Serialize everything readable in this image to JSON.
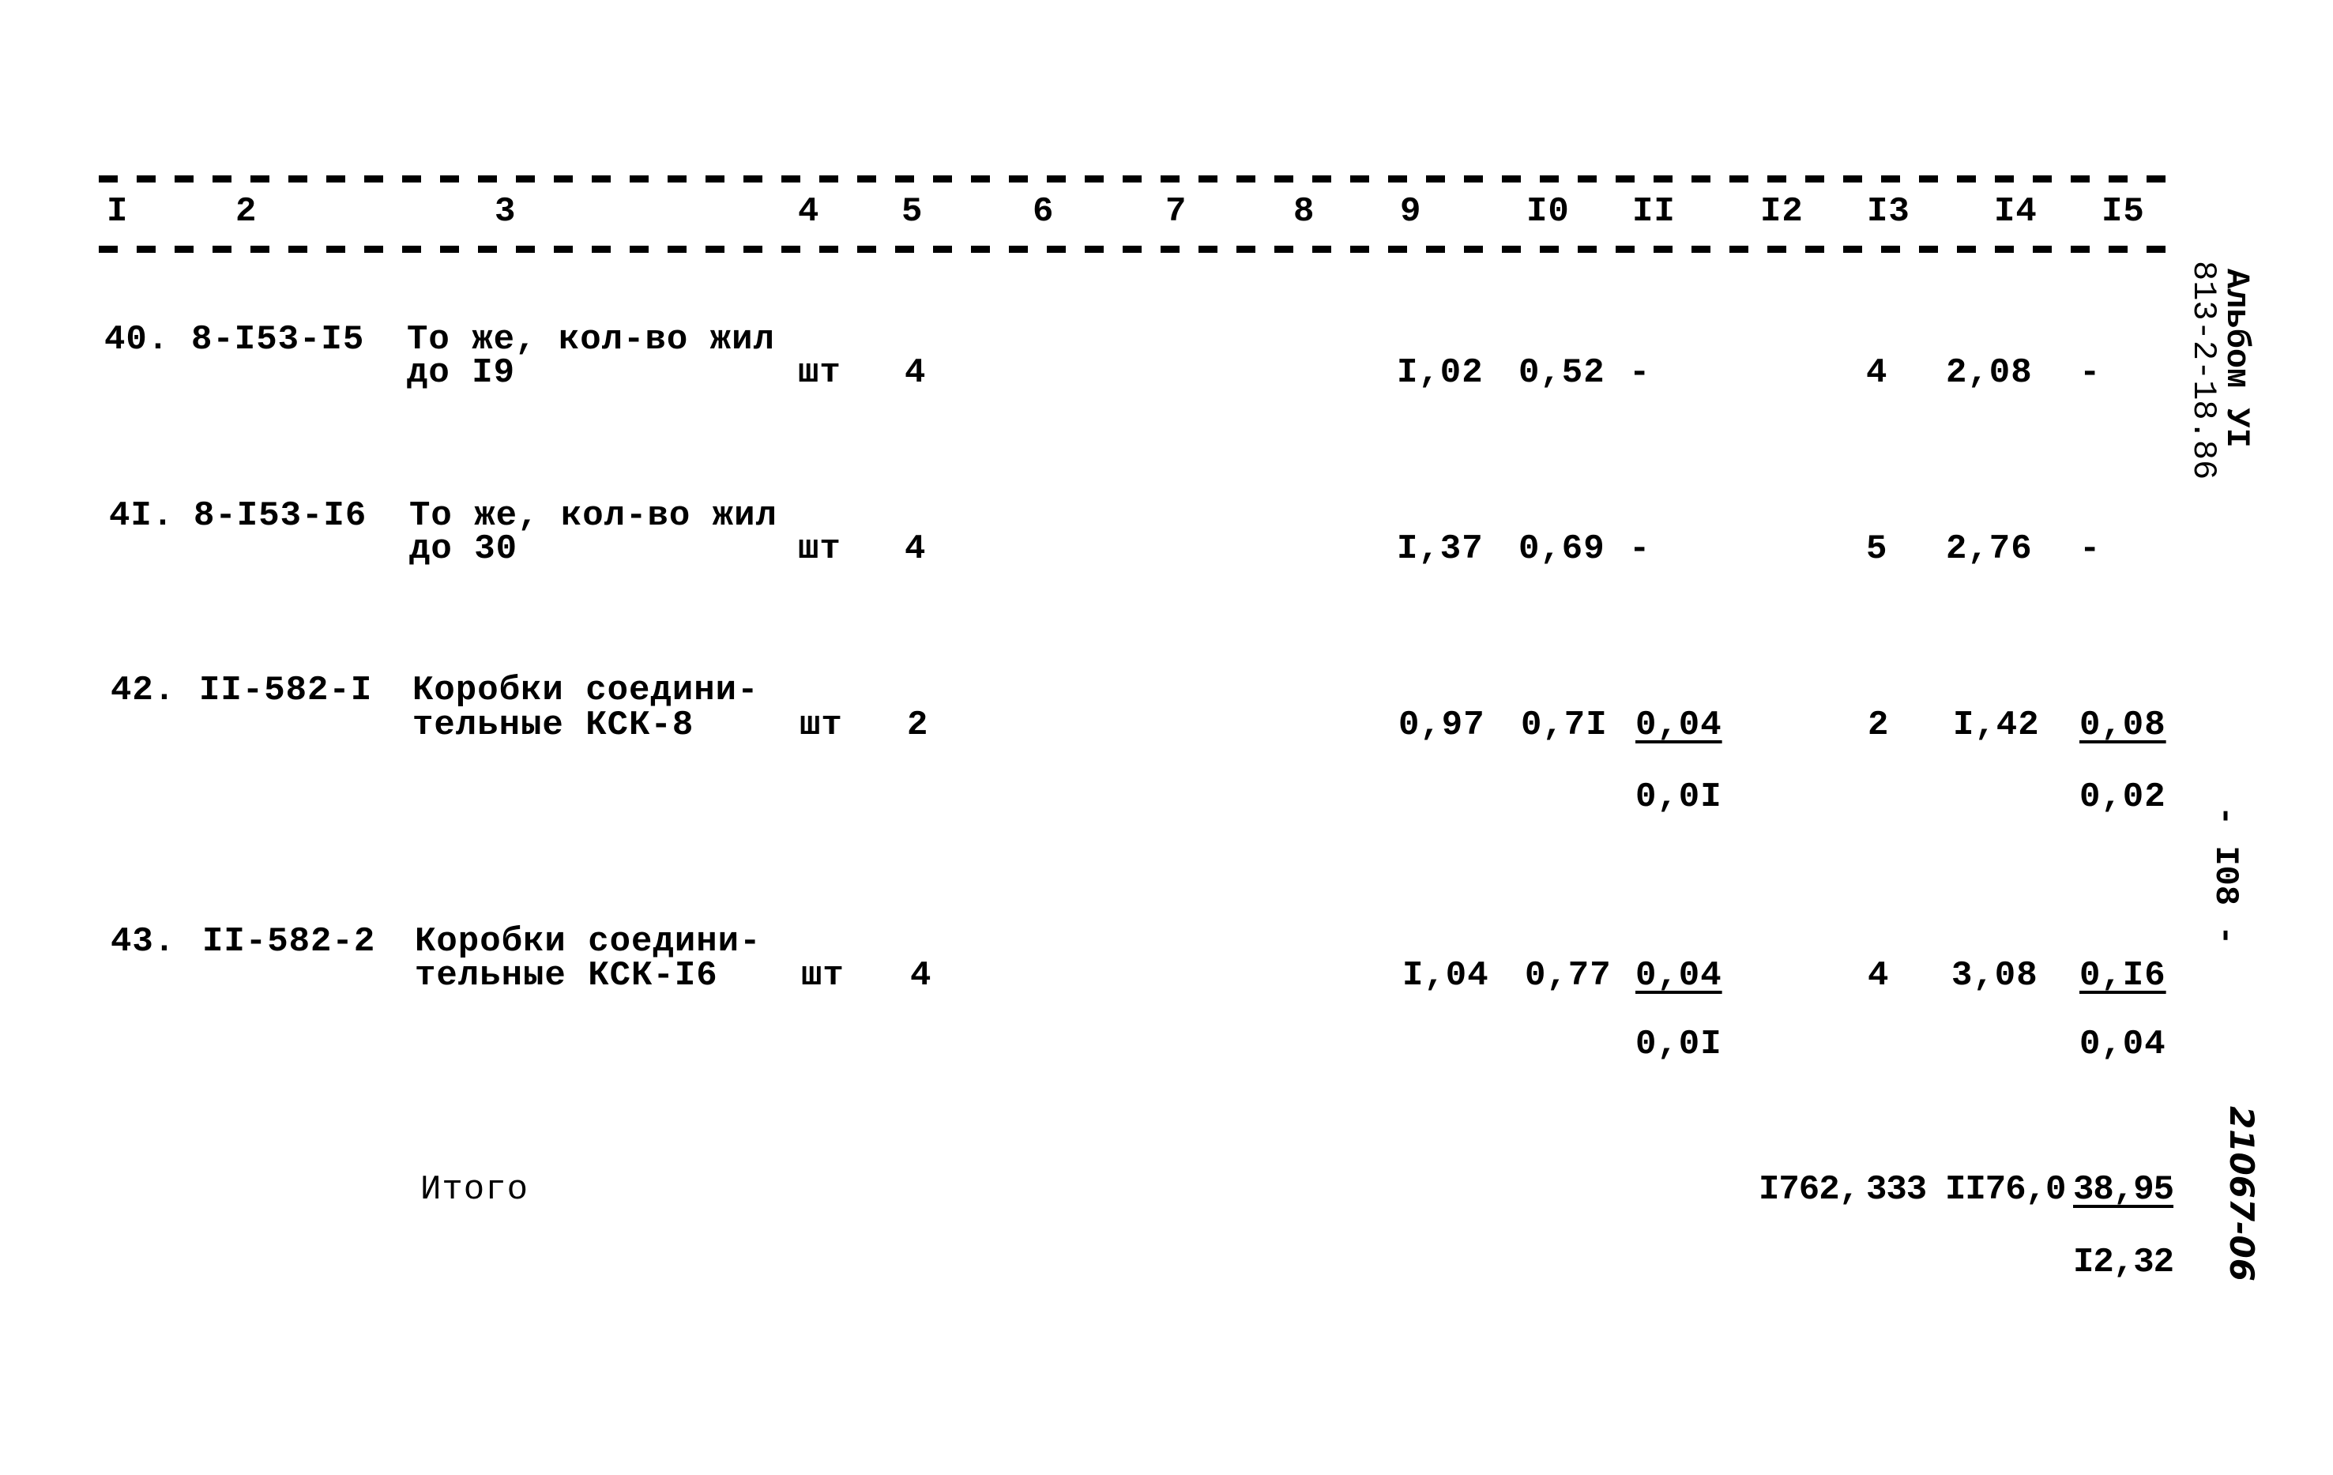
{
  "header": {
    "columns": [
      "I",
      "2",
      "3",
      "4",
      "5",
      "6",
      "7",
      "8",
      "9",
      "I0",
      "II",
      "I2",
      "I3",
      "I4",
      "I5"
    ]
  },
  "rows": [
    {
      "num": "40.",
      "code": "8-I53-I5",
      "name_line1": "То же, кол-во жил",
      "name_line2": "до I9",
      "unit": "шт",
      "qty": "4",
      "c9": "I,02",
      "c10": "0,52",
      "c11": "-",
      "c11_sub": "",
      "c13": "4",
      "c14": "2,08",
      "c15": "-",
      "c15_sub": ""
    },
    {
      "num": "4I.",
      "code": "8-I53-I6",
      "name_line1": "То же, кол-во жил",
      "name_line2": "до 30",
      "unit": "шт",
      "qty": "4",
      "c9": "I,37",
      "c10": "0,69",
      "c11": "-",
      "c11_sub": "",
      "c13": "5",
      "c14": "2,76",
      "c15": "-",
      "c15_sub": ""
    },
    {
      "num": "42.",
      "code": "II-582-I",
      "name_line1": "Коробки соедини-",
      "name_line2": "тельные КСК-8",
      "unit": "шт",
      "qty": "2",
      "c9": "0,97",
      "c10": "0,7I",
      "c11": "0,04",
      "c11_sub": "0,0I",
      "c13": "2",
      "c14": "I,42",
      "c15": "0,08",
      "c15_sub": "0,02"
    },
    {
      "num": "43.",
      "code": "II-582-2",
      "name_line1": "Коробки соедини-",
      "name_line2": "тельные КСК-I6",
      "unit": "шт",
      "qty": "4",
      "c9": "I,04",
      "c10": "0,77",
      "c11": "0,04",
      "c11_sub": "0,0I",
      "c13": "4",
      "c14": "3,08",
      "c15": "0,I6",
      "c15_sub": "0,04"
    }
  ],
  "total": {
    "label": "Итого",
    "c12": "I762,",
    "c13": "333",
    "c14": "II76,0",
    "c15": "38,95",
    "c15_sub": "I2,32"
  },
  "margin": {
    "album_stamp": "Альбом УI",
    "project_code": "813-2-18.86",
    "page_number": "- I08 -",
    "doc_number": "21067-06"
  }
}
